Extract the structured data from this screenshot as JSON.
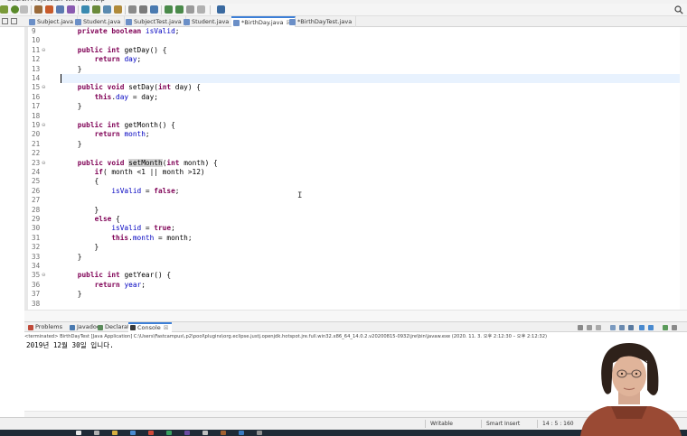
{
  "menu": {
    "items": [
      "Search",
      "Project",
      "Run",
      "Window",
      "Help"
    ]
  },
  "editor_tabs": [
    {
      "label": "Subject.java",
      "active": false
    },
    {
      "label": "Student.java",
      "active": false
    },
    {
      "label": "SubjectTest.java",
      "active": false
    },
    {
      "label": "Student.java",
      "active": false
    },
    {
      "label": "*BirthDay.java",
      "active": true,
      "close": "☒"
    },
    {
      "label": "*BirthDayTest.java",
      "active": false
    }
  ],
  "code_lines": [
    {
      "n": "9",
      "fold": "",
      "tokens": [
        {
          "t": "    "
        },
        {
          "t": "private",
          "k": "kw"
        },
        {
          "t": " "
        },
        {
          "t": "boolean",
          "k": "kw"
        },
        {
          "t": " "
        },
        {
          "t": "isValid",
          "k": "fld"
        },
        {
          "t": ";"
        }
      ]
    },
    {
      "n": "10",
      "fold": "",
      "tokens": []
    },
    {
      "n": "11",
      "fold": "⊖",
      "tokens": [
        {
          "t": "    "
        },
        {
          "t": "public",
          "k": "kw"
        },
        {
          "t": " "
        },
        {
          "t": "int",
          "k": "kw"
        },
        {
          "t": " getDay() {"
        }
      ]
    },
    {
      "n": "12",
      "fold": "",
      "tokens": [
        {
          "t": "        "
        },
        {
          "t": "return",
          "k": "kw"
        },
        {
          "t": " "
        },
        {
          "t": "day",
          "k": "fld"
        },
        {
          "t": ";"
        }
      ]
    },
    {
      "n": "13",
      "fold": "",
      "tokens": [
        {
          "t": "    }"
        }
      ]
    },
    {
      "n": "14",
      "fold": "",
      "cur": true,
      "tokens": []
    },
    {
      "n": "15",
      "fold": "⊖",
      "tokens": [
        {
          "t": "    "
        },
        {
          "t": "public",
          "k": "kw"
        },
        {
          "t": " "
        },
        {
          "t": "void",
          "k": "kw"
        },
        {
          "t": " setDay("
        },
        {
          "t": "int",
          "k": "kw"
        },
        {
          "t": " day) {"
        }
      ]
    },
    {
      "n": "16",
      "fold": "",
      "tokens": [
        {
          "t": "        "
        },
        {
          "t": "this",
          "k": "kw"
        },
        {
          "t": "."
        },
        {
          "t": "day",
          "k": "fld"
        },
        {
          "t": " = day;"
        }
      ]
    },
    {
      "n": "17",
      "fold": "",
      "tokens": [
        {
          "t": "    }"
        }
      ]
    },
    {
      "n": "18",
      "fold": "",
      "tokens": []
    },
    {
      "n": "19",
      "fold": "⊖",
      "tokens": [
        {
          "t": "    "
        },
        {
          "t": "public",
          "k": "kw"
        },
        {
          "t": " "
        },
        {
          "t": "int",
          "k": "kw"
        },
        {
          "t": " getMonth() {"
        }
      ]
    },
    {
      "n": "20",
      "fold": "",
      "tokens": [
        {
          "t": "        "
        },
        {
          "t": "return",
          "k": "kw"
        },
        {
          "t": " "
        },
        {
          "t": "month",
          "k": "fld"
        },
        {
          "t": ";"
        }
      ]
    },
    {
      "n": "21",
      "fold": "",
      "tokens": [
        {
          "t": "    }"
        }
      ]
    },
    {
      "n": "22",
      "fold": "",
      "tokens": []
    },
    {
      "n": "23",
      "fold": "⊖",
      "tokens": [
        {
          "t": "    "
        },
        {
          "t": "public",
          "k": "kw"
        },
        {
          "t": " "
        },
        {
          "t": "void",
          "k": "kw"
        },
        {
          "t": " "
        },
        {
          "t": "setMonth",
          "k": "hl"
        },
        {
          "t": "("
        },
        {
          "t": "int",
          "k": "kw"
        },
        {
          "t": " month) {"
        }
      ]
    },
    {
      "n": "24",
      "fold": "",
      "tokens": [
        {
          "t": "        "
        },
        {
          "t": "if",
          "k": "kw"
        },
        {
          "t": "( month <1 || month >12)"
        }
      ]
    },
    {
      "n": "25",
      "fold": "",
      "tokens": [
        {
          "t": "        {"
        }
      ]
    },
    {
      "n": "26",
      "fold": "",
      "tokens": [
        {
          "t": "            "
        },
        {
          "t": "isValid",
          "k": "fld"
        },
        {
          "t": " = "
        },
        {
          "t": "false",
          "k": "kw"
        },
        {
          "t": ";"
        }
      ]
    },
    {
      "n": "27",
      "fold": "",
      "tokens": []
    },
    {
      "n": "28",
      "fold": "",
      "tokens": [
        {
          "t": "        }"
        }
      ]
    },
    {
      "n": "29",
      "fold": "",
      "tokens": [
        {
          "t": "        "
        },
        {
          "t": "else",
          "k": "kw"
        },
        {
          "t": " {"
        }
      ]
    },
    {
      "n": "30",
      "fold": "",
      "tokens": [
        {
          "t": "            "
        },
        {
          "t": "isValid",
          "k": "fld"
        },
        {
          "t": " = "
        },
        {
          "t": "true",
          "k": "kw"
        },
        {
          "t": ";"
        }
      ]
    },
    {
      "n": "31",
      "fold": "",
      "tokens": [
        {
          "t": "            "
        },
        {
          "t": "this",
          "k": "kw"
        },
        {
          "t": "."
        },
        {
          "t": "month",
          "k": "fld"
        },
        {
          "t": " = month;"
        }
      ]
    },
    {
      "n": "32",
      "fold": "",
      "tokens": [
        {
          "t": "        }"
        }
      ]
    },
    {
      "n": "33",
      "fold": "",
      "tokens": [
        {
          "t": "    }"
        }
      ]
    },
    {
      "n": "34",
      "fold": "",
      "tokens": []
    },
    {
      "n": "35",
      "fold": "⊖",
      "tokens": [
        {
          "t": "    "
        },
        {
          "t": "public",
          "k": "kw"
        },
        {
          "t": " "
        },
        {
          "t": "int",
          "k": "kw"
        },
        {
          "t": " getYear() {"
        }
      ]
    },
    {
      "n": "36",
      "fold": "",
      "tokens": [
        {
          "t": "        "
        },
        {
          "t": "return",
          "k": "kw"
        },
        {
          "t": " "
        },
        {
          "t": "year",
          "k": "fld"
        },
        {
          "t": ";"
        }
      ]
    },
    {
      "n": "37",
      "fold": "",
      "tokens": [
        {
          "t": "    }"
        }
      ]
    },
    {
      "n": "38",
      "fold": "",
      "tokens": []
    }
  ],
  "bottom_tabs": [
    {
      "label": "Problems",
      "icon": "problems-icon",
      "active": false
    },
    {
      "label": "Javadoc",
      "icon": "javadoc-icon",
      "active": false
    },
    {
      "label": "Declaration",
      "icon": "declaration-icon",
      "active": false
    },
    {
      "label": "Console",
      "icon": "console-icon",
      "active": true,
      "close": "☒"
    }
  ],
  "console": {
    "status": "<terminated> BirthDayTest [Java Application] C:\\Users\\Fastcampus\\.p2\\pool\\plugins\\org.eclipse.justj.openjdk.hotspot.jre.full.win32.x86_64_14.0.2.v20200815-0932\\jre\\bin\\javaw.exe  (2020. 11. 3. 오후 2:12:30 – 오후 2:12:32)",
    "output": "2019년 12월 30일 입니다."
  },
  "statusbar": {
    "writable": "Writable",
    "insert_mode": "Smart Insert",
    "position": "14 : 5 : 160"
  },
  "colors": {
    "keyword": "#7f0055",
    "field": "#0000c0",
    "current_line": "#e8f2fe",
    "active_tab_accent": "#3d7fd6"
  }
}
